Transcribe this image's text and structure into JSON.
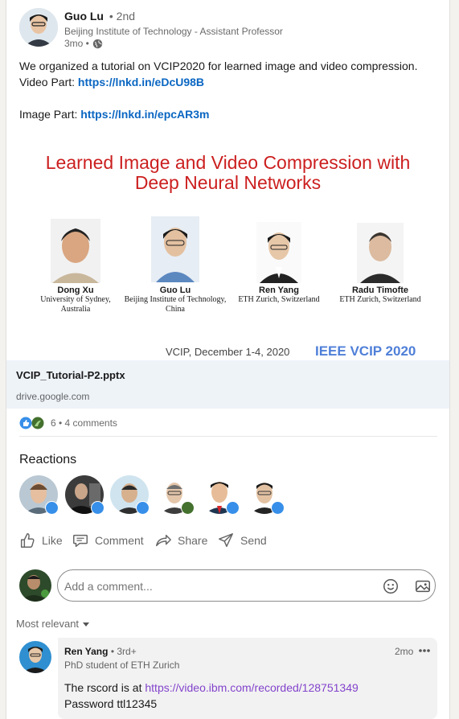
{
  "post": {
    "author_name": "Guo Lu",
    "degree": "• 2nd",
    "headline": "Beijing Institute of Technology - Assistant Professor",
    "time": "3mo •",
    "text_line1": "We organized a tutorial on VCIP2020 for learned image and video compression.",
    "video_label": "Video Part: ",
    "video_link": "https://lnkd.in/eDcU98B",
    "image_label": "Image Part: ",
    "image_link": "https://lnkd.in/epcAR3m"
  },
  "slide": {
    "title_line1": "Learned Image and Video Compression with",
    "title_line2": "Deep Neural Networks",
    "people": [
      {
        "name": "Dong Xu",
        "aff": "University of Sydney, Australia"
      },
      {
        "name": "Guo Lu",
        "aff": "Beijing Institute of Technology, China"
      },
      {
        "name": "Ren Yang",
        "aff": "ETH Zurich, Switzerland"
      },
      {
        "name": "Radu Timofte",
        "aff": "ETH Zurich, Switzerland"
      }
    ],
    "footer_date": "VCIP, December 1-4, 2020",
    "footer_brand": "IEEE VCIP 2020"
  },
  "attachment": {
    "filename": "VCIP_Tutorial-P2.pptx",
    "domain": "drive.google.com"
  },
  "social": {
    "count_text": "6 • 4 comments"
  },
  "reactions": {
    "title": "Reactions"
  },
  "actions": {
    "like": "Like",
    "comment": "Comment",
    "share": "Share",
    "send": "Send"
  },
  "comment_box": {
    "placeholder": "Add a comment..."
  },
  "sort": {
    "label": "Most relevant"
  },
  "comment": {
    "author": "Ren Yang",
    "degree": "• 3rd+",
    "headline": "PhD student of ETH Zurich",
    "time": "2mo",
    "line1_prefix": "The rscord is at ",
    "link": "https://video.ibm.com/recorded/128751349",
    "line2": "Password ttl12345"
  },
  "colors": {
    "link": "#0a66c2",
    "slide_title": "#cc1f1f",
    "slide_brand": "#4f7fd8",
    "like_badge": "#378fe9",
    "support_badge": "#44712e"
  }
}
